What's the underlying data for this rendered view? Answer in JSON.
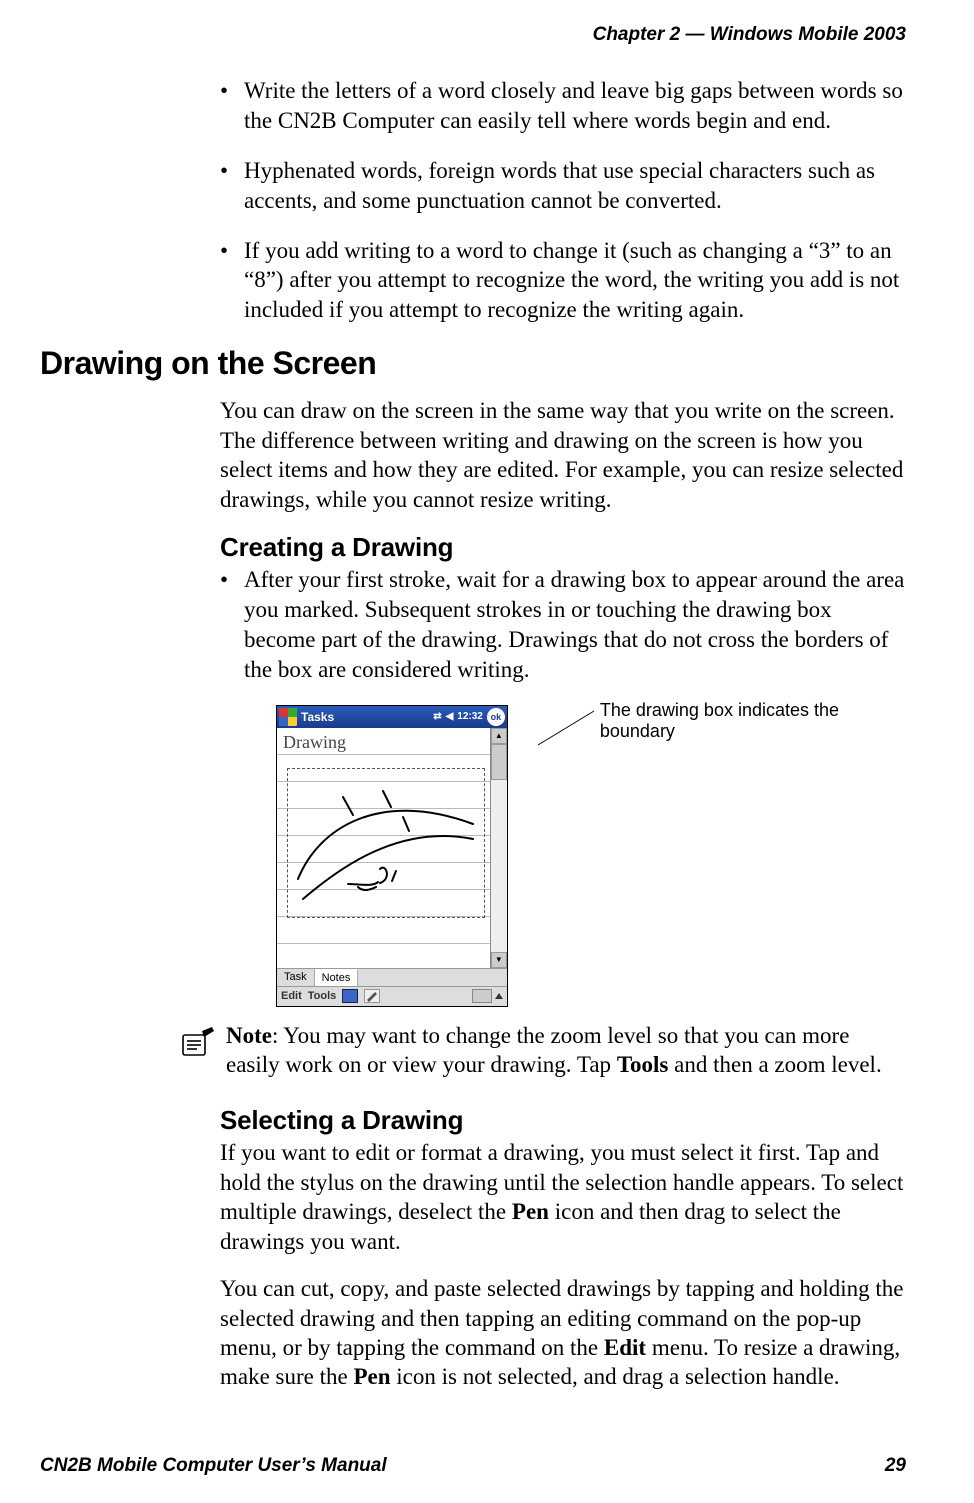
{
  "header": {
    "right": "Chapter 2 —  Windows Mobile 2003"
  },
  "bullets_top": [
    "Write the letters of a word closely and leave big gaps between words so the CN2B Computer can easily tell where words begin and end.",
    "Hyphenated words, foreign words that use special characters such as accents, and some punctuation cannot be converted.",
    "If you add writing to a word to change it (such as changing a “3” to an “8”) after you attempt to recognize the word, the writing you add is not included if you attempt to recognize the writing again."
  ],
  "h1": "Drawing on the Screen",
  "p1": "You can draw on the screen in the same way that you write on the screen. The difference between writing and drawing on the screen is how you select items and how they are edited. For example, you can resize selected drawings, while you cannot resize writing.",
  "h2a": "Creating a Drawing",
  "bullet_create": "After your first stroke, wait for a drawing box to appear around the area you marked. Subsequent strokes in or touching the drawing box become part of the drawing. Drawings that do not cross the borders of the box are considered writing.",
  "figure": {
    "title": "Tasks",
    "time": "12:32",
    "ok": "ok",
    "handwriting": "Drawing",
    "tabs": [
      "Task",
      "Notes"
    ],
    "bottombar": {
      "edit": "Edit",
      "tools": "Tools"
    },
    "caption": "The drawing box indicates the boundary"
  },
  "note_text_1": "Note",
  "note_text_2": ": You may want to change the zoom level so that you can more easily work on or view your drawing. Tap ",
  "note_tools": "Tools",
  "note_text_3": " and then a zoom level.",
  "h2b": "Selecting a Drawing",
  "p_sel_1a": "If you want to edit or format a drawing, you must select it first. Tap and hold the stylus on the drawing until the selection handle appears. To select multiple drawings, deselect the ",
  "p_sel_pen1": "Pen",
  "p_sel_1b": " icon and then drag to select the drawings you want.",
  "p_sel_2a": "You can cut, copy, and paste selected drawings by tapping and holding the selected drawing and then tapping an editing command on the pop-up menu, or by tapping the command on the ",
  "p_sel_edit": "Edit",
  "p_sel_2b": " menu. To resize a drawing, make sure the ",
  "p_sel_pen2": "Pen",
  "p_sel_2c": " icon is not selected, and drag a selection handle.",
  "footer": {
    "left": "CN2B Mobile Computer User’s Manual",
    "right": "29"
  }
}
